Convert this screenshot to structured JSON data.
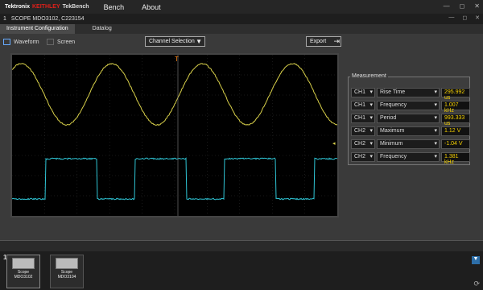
{
  "titlebar": {
    "brand_tek": "Tektronix",
    "brand_keithley": "KEITHLEY",
    "brand_tb": "TekBench",
    "menu": [
      "Bench",
      "About"
    ],
    "controls": [
      "—",
      "◻",
      "✕"
    ]
  },
  "scopebar": {
    "num": "1",
    "title": "SCOPE MDO3102, C223154",
    "controls": [
      "—",
      "◻",
      "✕"
    ]
  },
  "tabs": [
    "Instrument Configuration",
    "Datalog"
  ],
  "toolbar": {
    "waveform_label": "Waveform",
    "screen_label": "Screen",
    "channel_selection": "Channel Selection",
    "export_label": "Export"
  },
  "measurement": {
    "title": "Measurement",
    "rows": [
      {
        "ch": "CH1",
        "type": "Rise Time",
        "value": "295.992 us"
      },
      {
        "ch": "CH1",
        "type": "Frequency",
        "value": "1.007 kHz"
      },
      {
        "ch": "CH1",
        "type": "Period",
        "value": "993.333 us"
      },
      {
        "ch": "CH2",
        "type": "Maximum",
        "value": "1.12 V"
      },
      {
        "ch": "CH2",
        "type": "Minimum",
        "value": "-1.04 V"
      },
      {
        "ch": "CH2",
        "type": "Frequency",
        "value": "1.381 kHz"
      }
    ]
  },
  "tray": {
    "num": "1",
    "scopes": [
      {
        "label": "Scope",
        "model": "MDO3102"
      },
      {
        "label": "Scope",
        "model": "MDO3104"
      }
    ]
  },
  "colors": {
    "ch1": "#d8d04a",
    "ch2": "#2fc6d6",
    "accent": "#2d6ea8"
  }
}
